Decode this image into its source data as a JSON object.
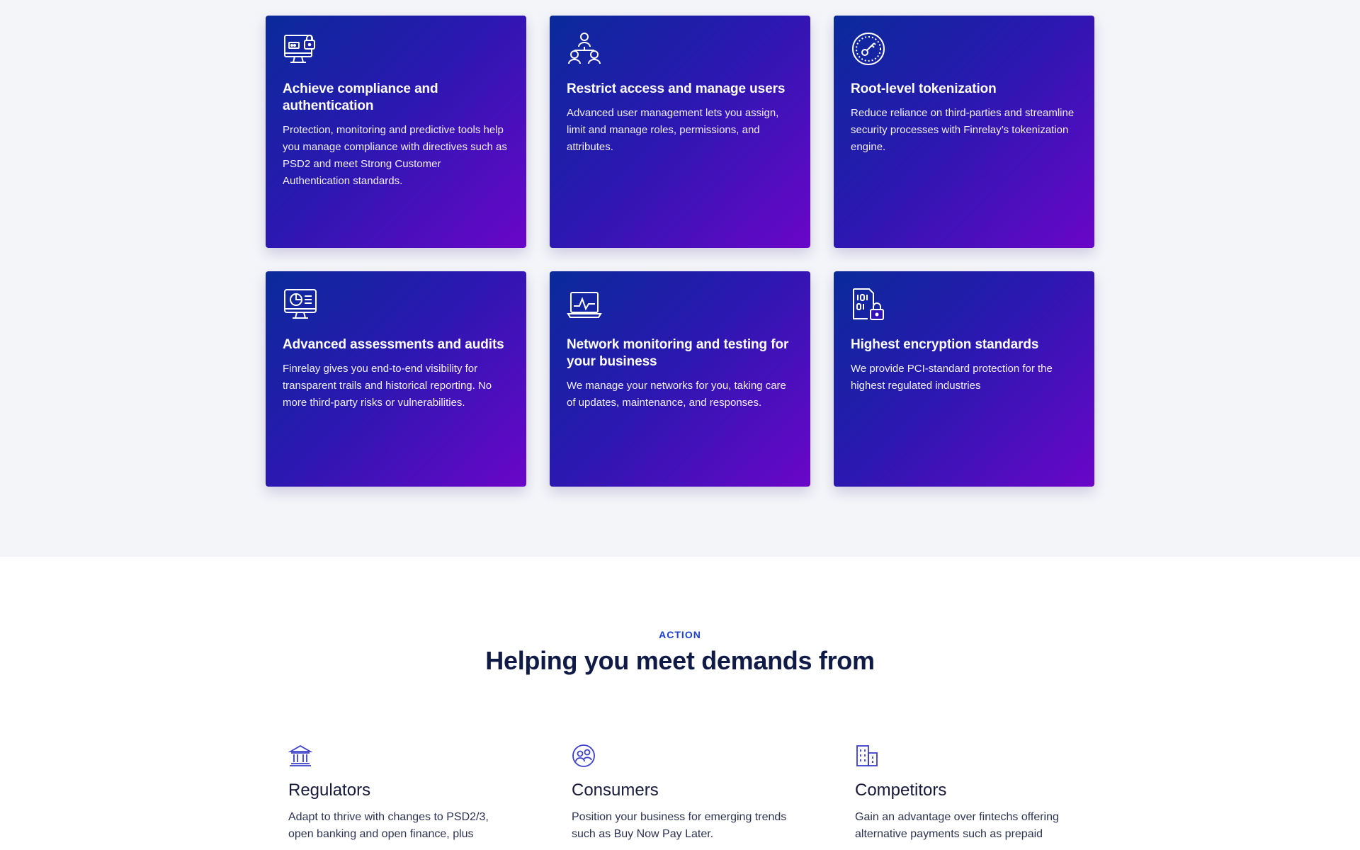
{
  "features": {
    "cards": [
      {
        "icon": "monitor-lock-icon",
        "title": "Achieve compliance and authentication",
        "text": "Protection, monitoring and predictive tools help you manage compliance with directives such as PSD2 and meet Strong Customer Authentication standards."
      },
      {
        "icon": "user-hierarchy-icon",
        "title": "Restrict access and manage users",
        "text": "Advanced user management lets you assign, limit and manage roles, permissions, and attributes."
      },
      {
        "icon": "key-circle-icon",
        "title": "Root-level tokenization",
        "text": "Reduce reliance on third-parties and streamline security processes with Finrelay’s tokenization engine."
      },
      {
        "icon": "monitor-chart-icon",
        "title": "Advanced assessments and audits",
        "text": "Finrelay gives you end-to-end visibility for transparent trails and historical reporting. No more third-party risks or vulnerabilities."
      },
      {
        "icon": "laptop-pulse-icon",
        "title": "Network monitoring and testing for your business",
        "text": "We manage your networks for you, taking care of updates, maintenance, and responses."
      },
      {
        "icon": "binary-lock-icon",
        "title": "Highest encryption standards",
        "text": "We provide PCI-standard protection for the highest regulated industries"
      }
    ]
  },
  "action": {
    "eyebrow": "ACTION",
    "heading": "Helping you meet demands from",
    "items": [
      {
        "icon": "bank-icon",
        "title": "Regulators",
        "text": "Adapt to thrive with changes to PSD2/3, open banking and open finance, plus"
      },
      {
        "icon": "users-circle-icon",
        "title": "Consumers",
        "text": "Position your business for emerging trends such as Buy Now Pay Later."
      },
      {
        "icon": "buildings-icon",
        "title": "Competitors",
        "text": "Gain an advantage over fintechs offering alternative payments such as prepaid"
      }
    ]
  },
  "colors": {
    "card_gradient_start": "#0a2a9a",
    "card_gradient_end": "#6a06c8",
    "eyebrow": "#1d3fd0",
    "heading": "#101a46",
    "icon_accent": "#3b3fc9"
  }
}
